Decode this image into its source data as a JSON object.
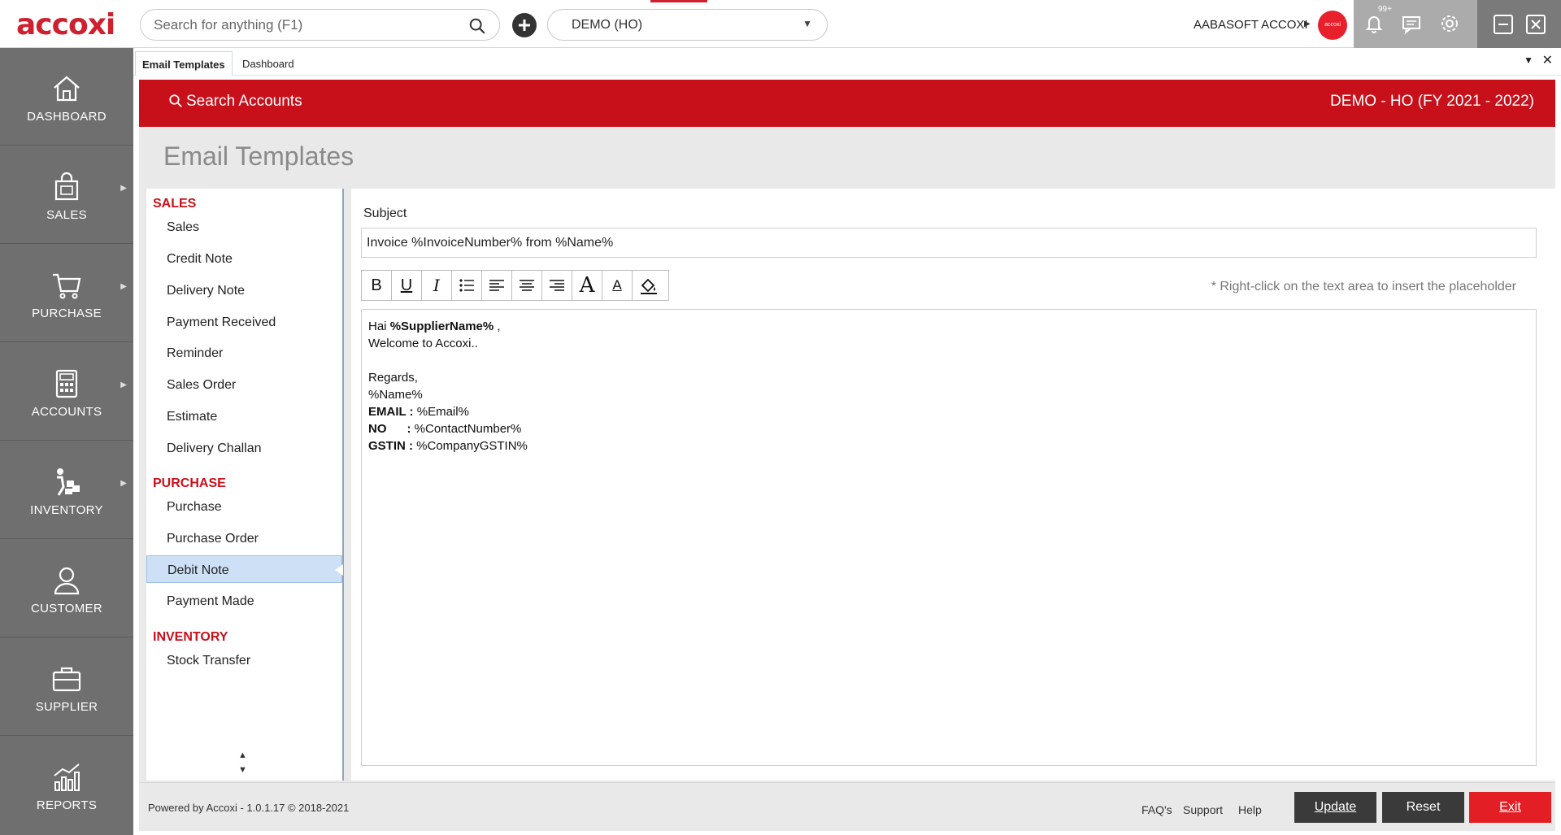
{
  "app": {
    "logo": "accoxi",
    "search_placeholder": "Search for anything (F1)",
    "company_selected": "DEMO (HO)",
    "user_name": "AABASOFT ACCOXI",
    "avatar_text": "accoxi",
    "notification_count": "99+",
    "accent": "#c8101b"
  },
  "sidebar": {
    "items": [
      {
        "label": "DASHBOARD",
        "icon": "home-icon"
      },
      {
        "label": "SALES",
        "icon": "shopping-bag-icon"
      },
      {
        "label": "PURCHASE",
        "icon": "cart-icon"
      },
      {
        "label": "ACCOUNTS",
        "icon": "calculator-icon"
      },
      {
        "label": "INVENTORY",
        "icon": "inventory-icon"
      },
      {
        "label": "CUSTOMER",
        "icon": "person-icon"
      },
      {
        "label": "SUPPLIER",
        "icon": "briefcase-icon"
      },
      {
        "label": "REPORTS",
        "icon": "chart-icon"
      }
    ]
  },
  "tabs": [
    {
      "label": "Email Templates",
      "active": true
    },
    {
      "label": "Dashboard",
      "active": false
    }
  ],
  "header": {
    "search_label": "Search Accounts",
    "company": "DEMO - HO (FY 2021 - 2022)"
  },
  "page": {
    "title": "Email Templates"
  },
  "templates": {
    "groups": [
      {
        "heading": "SALES",
        "items": [
          "Sales",
          "Credit Note",
          "Delivery Note",
          "Payment Received",
          "Reminder",
          "Sales Order",
          "Estimate",
          "Delivery Challan"
        ]
      },
      {
        "heading": "PURCHASE",
        "items": [
          "Purchase",
          "Purchase Order",
          "Debit Note",
          "Payment Made"
        ]
      },
      {
        "heading": "INVENTORY",
        "items": [
          "Stock Transfer"
        ]
      }
    ],
    "selected": "Debit Note"
  },
  "editor": {
    "subject_label": "Subject",
    "subject_value": "Invoice  %InvoiceNumber%  from %Name%",
    "hint": "* Right-click on the text area to insert the placeholder",
    "body": {
      "greeting": "Hai ",
      "greeting_placeholder": "%SupplierName%",
      "greeting_end": " ,",
      "line2": "Welcome to Accoxi..",
      "line4": "Regards,",
      "line5": "%Name%",
      "email_label": "EMAIL :",
      "email_value": " %Email%",
      "no_label": "NO      :",
      "no_value": " %ContactNumber%",
      "gstin_label": "GSTIN :",
      "gstin_value": " %CompanyGSTIN%"
    }
  },
  "footer": {
    "powered": "Powered by Accoxi - 1.0.1.17 © 2018-2021",
    "faq": "FAQ's",
    "support": "Support",
    "help": "Help",
    "update": "Update",
    "reset": "Reset",
    "exit": "Exit"
  }
}
